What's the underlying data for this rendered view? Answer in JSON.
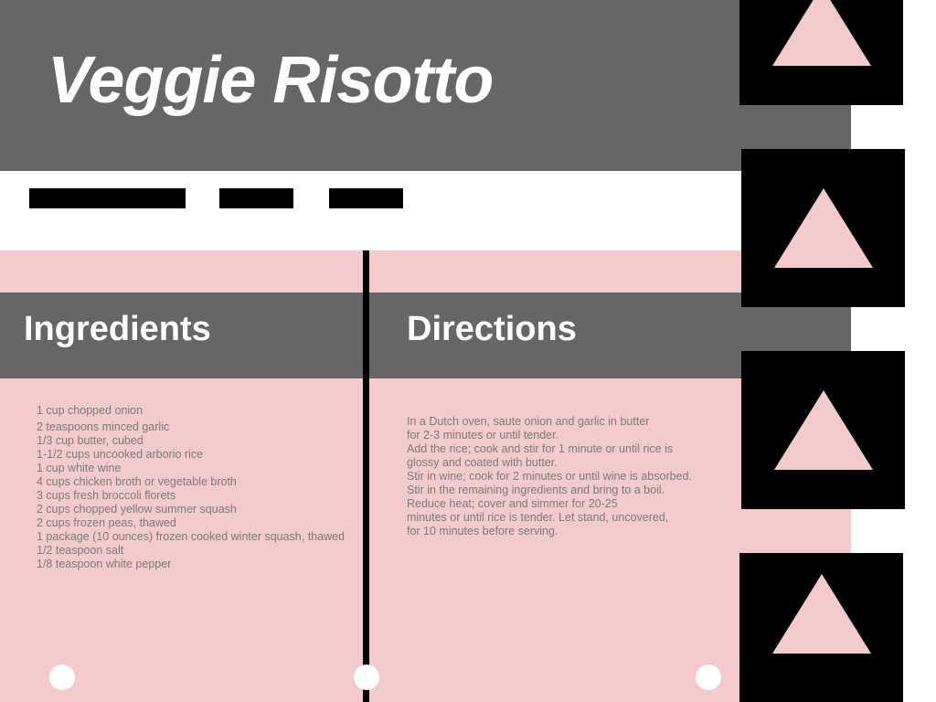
{
  "header": {
    "title": "Veggie Risotto"
  },
  "sections": {
    "ingredients_title": "Ingredients",
    "directions_title": "Directions"
  },
  "ingredients": [
    "1 cup chopped onion",
    "2 teaspoons minced garlic",
    "1/3 cup butter, cubed",
    "1-1/2 cups uncooked arborio rice",
    "1 cup white wine",
    "4 cups chicken broth or vegetable broth",
    "3 cups fresh broccoli florets",
    "2 cups chopped yellow summer squash",
    "2 cups frozen peas, thawed",
    "1 package (10 ounces) frozen cooked winter squash, thawed",
    "1/2 teaspoon salt",
    "1/8 teaspoon white pepper"
  ],
  "directions": [
    "In a Dutch oven, saute onion and garlic in butter",
    "for 2-3 minutes or until tender.",
    "Add the rice; cook and stir for 1 minute or until rice is",
    "glossy and coated with butter.",
    "Stir in wine; cook for 2 minutes or until wine is absorbed.",
    "Stir in the remaining ingredients and bring to a boil.",
    "Reduce heat; cover and simmer for 20-25",
    "minutes or until rice is tender. Let stand, uncovered,",
    "for 10 minutes before serving."
  ],
  "colors": {
    "header_gray": "#676665",
    "pink": "#f4cbcc",
    "black": "#000000",
    "text_gray": "#7a7a7a"
  },
  "icons": {
    "thumbnail_icon": "triangle-icon",
    "carousel_dot": "dot-icon"
  }
}
